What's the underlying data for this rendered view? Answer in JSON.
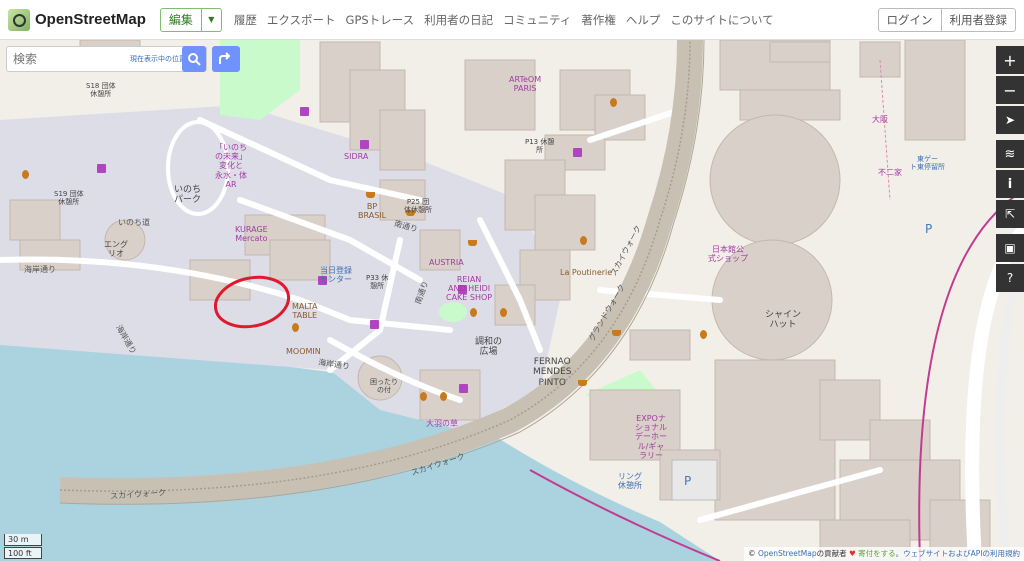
{
  "header": {
    "logo_text": "OpenStreetMap",
    "edit_label": "編集",
    "edit_dropdown": "▼",
    "nav": [
      "履歴",
      "エクスポート",
      "GPSトレース",
      "利用者の日記",
      "コミュニティ",
      "著作権",
      "ヘルプ",
      "このサイトについて"
    ],
    "login_label": "ログイン",
    "signup_label": "利用者登録"
  },
  "search": {
    "placeholder": "検索",
    "value": "検索",
    "where_am_i": "現在表示中の位置情報"
  },
  "map_controls": [
    "zoom-in-icon",
    "zoom-out-icon",
    "locate-icon",
    "layers-icon",
    "info-icon",
    "share-icon",
    "note-icon",
    "query-icon"
  ],
  "scale": {
    "metric": "30 m",
    "imperial": "100 ft"
  },
  "attribution": {
    "prefix": "©",
    "osm_link": "OpenStreetMap",
    "contributors": "の貢献者",
    "heart": "♥",
    "donate": "寄付をする",
    "tail": "。ウェブサイトおよびAPIの利用規約"
  },
  "map_labels": {
    "inochi_park": "いのち\nパーク",
    "s18": "S18 団体\n休憩所",
    "s19": "S19 団体\n休憩所",
    "inochi_mirai": "「いのち\nの未来」\n変化と\n永水・体\nAR",
    "entry": "エング\nリオ",
    "kurage": "KURAGE\nMercato",
    "sidra": "SIDRA",
    "arteom": "ARTeOM\nPARIS",
    "p13": "P13 休憩\n所",
    "p25": "P25 団\n体休憩所",
    "bp_brasil": "BP\nBRASIL",
    "austria": "AUSTRIA",
    "cake_shop": "REIAN\nAND HEIDI\nCAKE SHOP",
    "poutinerie": "La Poutinerie",
    "nichi_center": "当日登録\nセンター",
    "p33": "P33 休\n憩所",
    "malta": "MALTA\nTABLE",
    "moomin": "MOOMIN",
    "chowa": "調和の\n広場",
    "fernao": "FERNAO\nMENDES\nPINTO",
    "komatta": "困ったり\nの付",
    "ohane": "大羽の草",
    "expo": "EXPOナ\nショナル\nデーホー\nル/ギャ\nラリー",
    "ring": "リング\n休憩所",
    "shine": "シャイン\nハット",
    "nihon": "日本館公\n式ショップ",
    "road_kaigan1": "海岸通り",
    "road_kaigan2": "海岸通り",
    "road_kaigan3": "海岸通り",
    "road_minami1": "南通り",
    "road_minami2": "南通り",
    "road_inochi": "いのち道",
    "road_skywalk1": "スカイウォーク",
    "road_skywalk2": "スカイウォーク",
    "road_skywalk3": "スカイウォーク",
    "road_grand": "グランドウォーク",
    "station": "東ゲー\nト東停留所",
    "ome": "大阪",
    "fuji": "不二家"
  }
}
